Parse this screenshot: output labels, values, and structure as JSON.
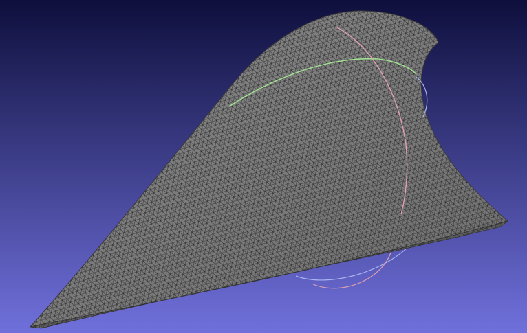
{
  "viewport": {
    "background_top": "#0e0f3c",
    "background_bottom": "#7070dc",
    "mesh_fill": "#7d7d7d",
    "mesh_fill_dark": "#5a5a5a",
    "wireframe_color": "#2c2c2c",
    "trackball": {
      "x_axis_color": "#e0a0b0",
      "y_axis_color": "#a0e090",
      "z_axis_color": "#a8b4ee"
    }
  }
}
